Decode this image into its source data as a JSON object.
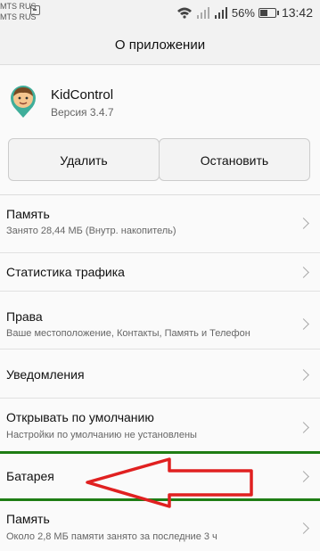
{
  "status_bar": {
    "carrier1": "MTS RUS",
    "carrier2": "MTS RUS",
    "battery_percent": "56%",
    "battery_level": 0.56,
    "time": "13:42",
    "icons": [
      "sim-icon",
      "wifi-icon",
      "signal-icon",
      "signal-icon",
      "battery-icon"
    ]
  },
  "header": {
    "title": "О приложении"
  },
  "app": {
    "name": "KidControl",
    "version": "Версия 3.4.7",
    "icon": "kidcontrol-app-icon"
  },
  "actions": {
    "delete_label": "Удалить",
    "stop_label": "Остановить"
  },
  "items": [
    {
      "title": "Память",
      "subtitle": "Занято 28,44 МБ (Внутр. накопитель)"
    },
    {
      "title": "Статистика трафика",
      "subtitle": ""
    },
    {
      "title": "Права",
      "subtitle": "Ваше местоположение, Контакты, Память и Телефон"
    },
    {
      "title": "Уведомления",
      "subtitle": ""
    },
    {
      "title": "Открывать по умолчанию",
      "subtitle": "Настройки по умолчанию не установлены"
    },
    {
      "title": "Батарея",
      "subtitle": ""
    },
    {
      "title": "Память",
      "subtitle": "Около 2,8 МБ памяти занято за последние 3 ч"
    }
  ],
  "colors": {
    "annotation_line": "#1e7d14",
    "annotation_arrow": "#e02020",
    "chevron": "#aaaaaa"
  }
}
